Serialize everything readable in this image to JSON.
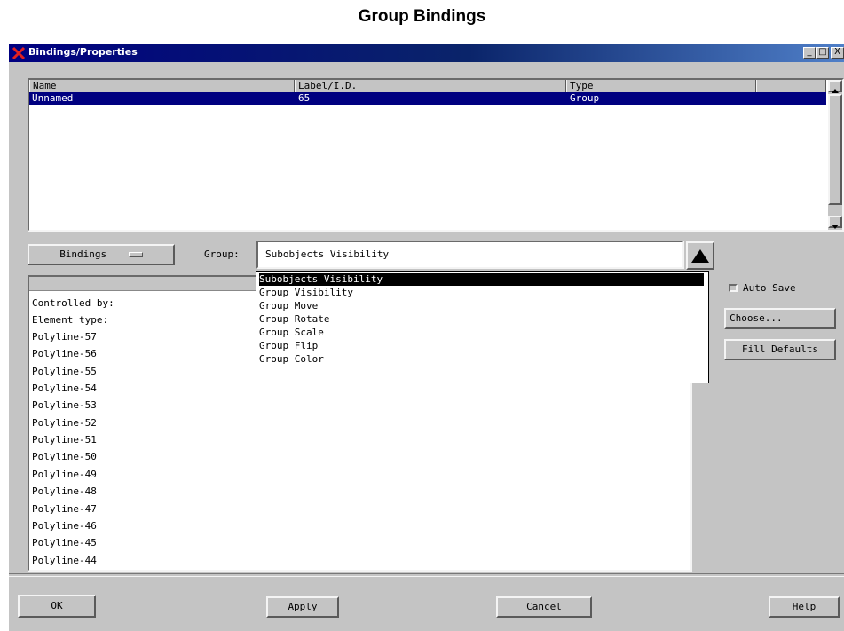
{
  "caption": "Group Bindings",
  "window": {
    "title": "Bindings/Properties",
    "controls": [
      "_",
      "□",
      "X"
    ]
  },
  "objects_table": {
    "columns": [
      "Name",
      "Label/I.D.",
      "Type"
    ],
    "rows": [
      {
        "name": "Unnamed",
        "label": "65",
        "type": "Group"
      }
    ]
  },
  "toolbar": {
    "mode_button": "Bindings",
    "group_label": "Group:",
    "group_value": "Subobjects Visibility"
  },
  "group_options": [
    "Subobjects Visibility",
    "Group Visibility",
    "Group Move",
    "Group Rotate",
    "Group Scale",
    "Group Flip",
    "Group Color"
  ],
  "elements_list": [
    "Controlled by:",
    "Element type:",
    "Polyline-57",
    "Polyline-56",
    "Polyline-55",
    "Polyline-54",
    "Polyline-53",
    "Polyline-52",
    "Polyline-51",
    "Polyline-50",
    "Polyline-49",
    "Polyline-48",
    "Polyline-47",
    "Polyline-46",
    "Polyline-45",
    "Polyline-44"
  ],
  "side_panel": {
    "auto_save": "Auto Save",
    "auto_save_checked": false,
    "choose": "Choose...",
    "fill_defaults": "Fill Defaults"
  },
  "footer": {
    "ok": "OK",
    "apply": "Apply",
    "cancel": "Cancel",
    "help": "Help"
  },
  "colors": {
    "selection": "#000080",
    "panel": "#c4c4c4",
    "titlebar": "#000080"
  }
}
